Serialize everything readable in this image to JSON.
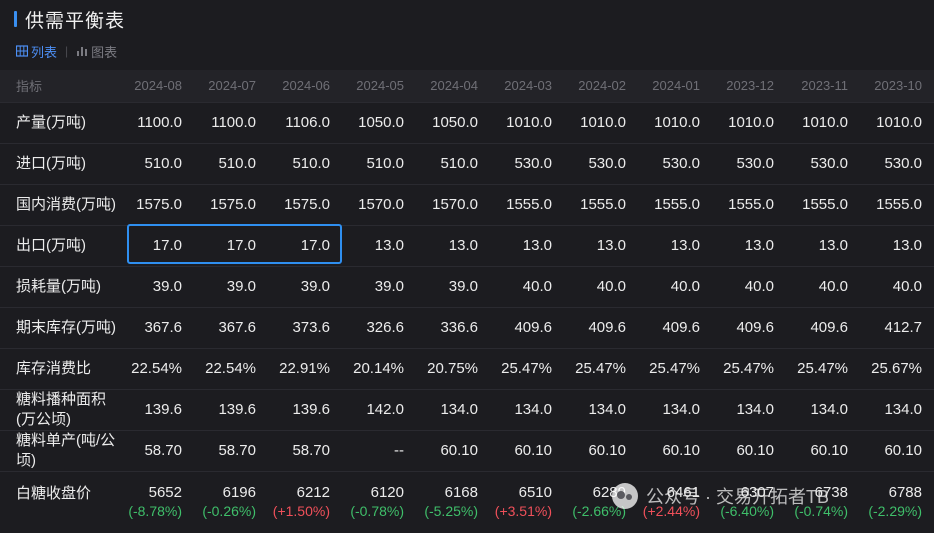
{
  "title": "供需平衡表",
  "tabs": [
    {
      "label": "列表",
      "icon": "table-icon",
      "active": true
    },
    {
      "label": "图表",
      "icon": "bar-chart-icon",
      "active": false
    }
  ],
  "columns": [
    "指标",
    "2024-08",
    "2024-07",
    "2024-06",
    "2024-05",
    "2024-04",
    "2024-03",
    "2024-02",
    "2024-01",
    "2023-12",
    "2023-11",
    "2023-10"
  ],
  "rows": [
    {
      "label": "产量(万吨)",
      "values": [
        "1100.0",
        "1100.0",
        "1106.0",
        "1050.0",
        "1050.0",
        "1010.0",
        "1010.0",
        "1010.0",
        "1010.0",
        "1010.0",
        "1010.0"
      ]
    },
    {
      "label": "进口(万吨)",
      "values": [
        "510.0",
        "510.0",
        "510.0",
        "510.0",
        "510.0",
        "530.0",
        "530.0",
        "530.0",
        "530.0",
        "530.0",
        "530.0"
      ]
    },
    {
      "label": "国内消费(万吨)",
      "values": [
        "1575.0",
        "1575.0",
        "1575.0",
        "1570.0",
        "1570.0",
        "1555.0",
        "1555.0",
        "1555.0",
        "1555.0",
        "1555.0",
        "1555.0"
      ]
    },
    {
      "label": "出口(万吨)",
      "values": [
        "17.0",
        "17.0",
        "17.0",
        "13.0",
        "13.0",
        "13.0",
        "13.0",
        "13.0",
        "13.0",
        "13.0",
        "13.0"
      ]
    },
    {
      "label": "损耗量(万吨)",
      "values": [
        "39.0",
        "39.0",
        "39.0",
        "39.0",
        "39.0",
        "40.0",
        "40.0",
        "40.0",
        "40.0",
        "40.0",
        "40.0"
      ]
    },
    {
      "label": "期末库存(万吨)",
      "values": [
        "367.6",
        "367.6",
        "373.6",
        "326.6",
        "336.6",
        "409.6",
        "409.6",
        "409.6",
        "409.6",
        "409.6",
        "412.7"
      ]
    },
    {
      "label": "库存消费比",
      "values": [
        "22.54%",
        "22.54%",
        "22.91%",
        "20.14%",
        "20.75%",
        "25.47%",
        "25.47%",
        "25.47%",
        "25.47%",
        "25.47%",
        "25.67%"
      ]
    },
    {
      "label": "糖料播种面积(万公顷)",
      "values": [
        "139.6",
        "139.6",
        "139.6",
        "142.0",
        "134.0",
        "134.0",
        "134.0",
        "134.0",
        "134.0",
        "134.0",
        "134.0"
      ]
    },
    {
      "label": "糖料单产(吨/公顷)",
      "values": [
        "58.70",
        "58.70",
        "58.70",
        "--",
        "60.10",
        "60.10",
        "60.10",
        "60.10",
        "60.10",
        "60.10",
        "60.10"
      ]
    }
  ],
  "price_row": {
    "label": "白糖收盘价",
    "values": [
      "5652",
      "6196",
      "6212",
      "6120",
      "6168",
      "6510",
      "6289",
      "6461",
      "6307",
      "6738",
      "6788"
    ],
    "changes": [
      "(-8.78%)",
      "(-0.26%)",
      "(+1.50%)",
      "(-0.78%)",
      "(-5.25%)",
      "(+3.51%)",
      "(-2.66%)",
      "(+2.44%)",
      "(-6.40%)",
      "(-0.74%)",
      "(-2.29%)"
    ],
    "change_colors": {
      "negative": "#3fbf6a",
      "positive": "#f0505a"
    }
  },
  "highlight": {
    "row": "出口(万吨)",
    "columns": [
      "2024-08",
      "2024-07",
      "2024-06"
    ],
    "color": "#2f8ff0"
  },
  "watermark": {
    "text": "公众号 · 交易开拓者TB",
    "icon": "wechat-logo-icon"
  },
  "colors": {
    "background": "#1c1c20",
    "accent": "#4d8ff5",
    "text": "#ececec",
    "muted": "#6f6f76"
  }
}
